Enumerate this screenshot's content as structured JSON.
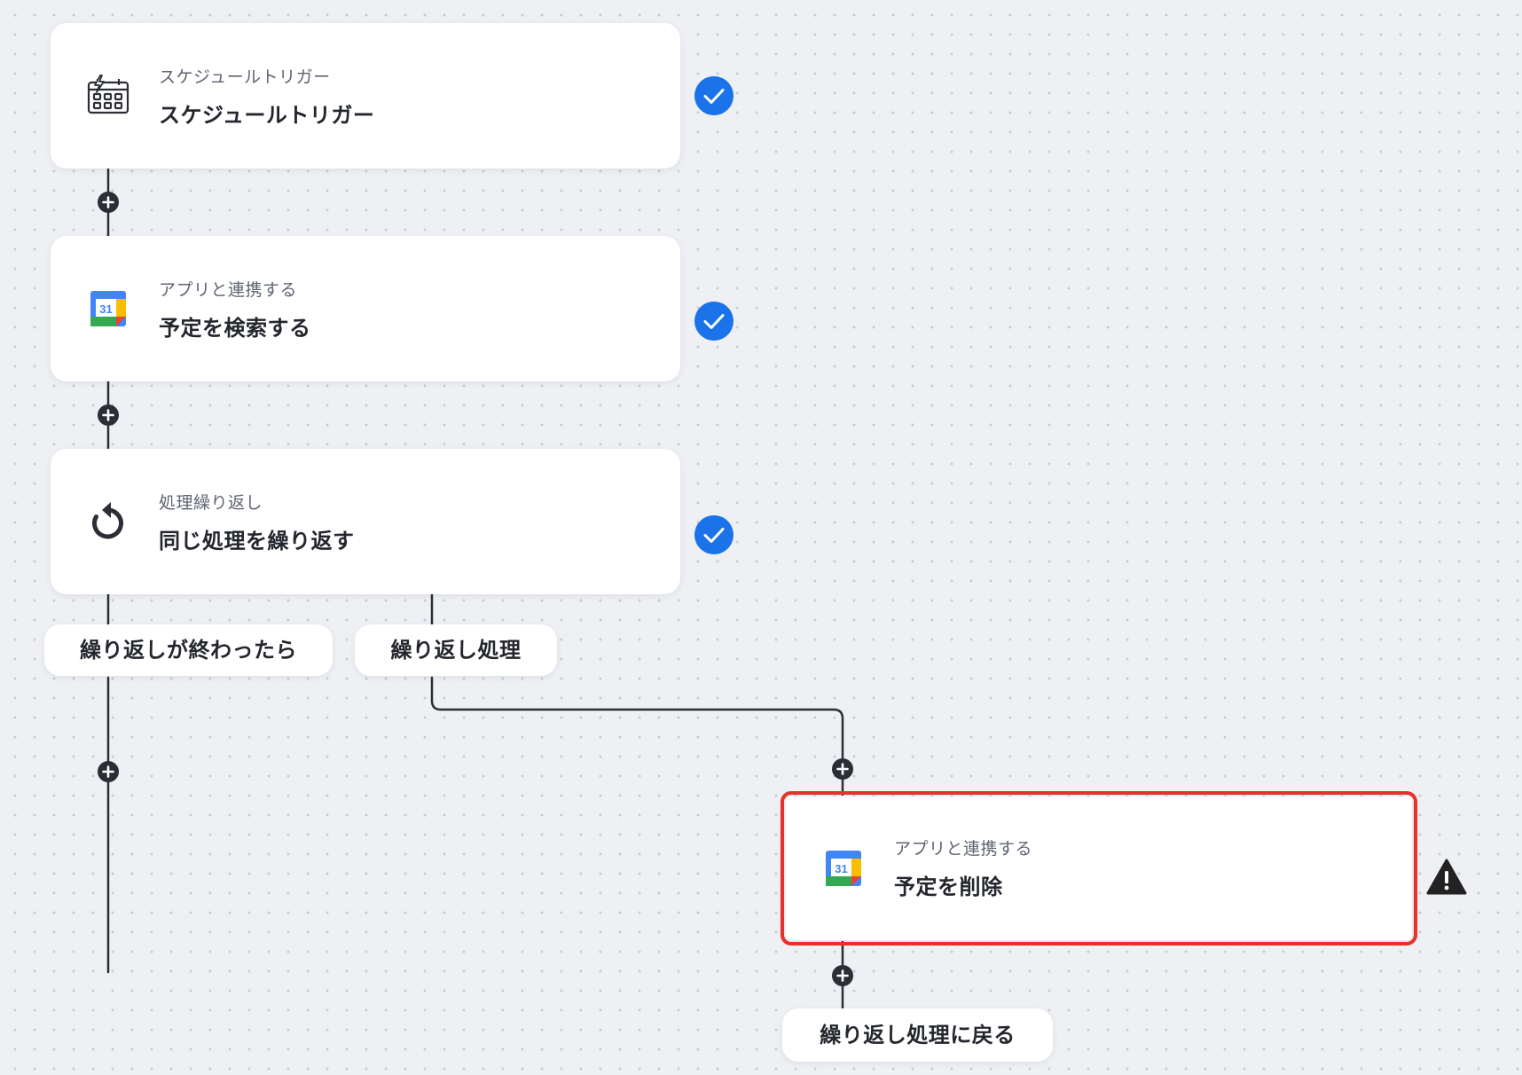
{
  "steps": [
    {
      "subtitle": "スケジュールトリガー",
      "title": "スケジュールトリガー",
      "icon": "schedule-trigger-icon",
      "status": "completed"
    },
    {
      "subtitle": "アプリと連携する",
      "title": "予定を検索する",
      "icon": "google-calendar-icon",
      "status": "completed"
    },
    {
      "subtitle": "処理繰り返し",
      "title": "同じ処理を繰り返す",
      "icon": "loop-icon",
      "status": "completed"
    },
    {
      "subtitle": "アプリと連携する",
      "title": "予定を削除",
      "icon": "google-calendar-icon",
      "status": "warning",
      "selected": true
    }
  ],
  "branches": {
    "after_loop_label": "繰り返しが終わったら",
    "loop_body_label": "繰り返し処理",
    "return_label": "繰り返し処理に戻る"
  },
  "calendar_icon": {
    "day": "31",
    "colors": {
      "blue": "#4285f4",
      "green": "#34a853",
      "yellow": "#fbbc04",
      "red": "#ea4335"
    }
  },
  "colors": {
    "check": "#1a73e8",
    "warning": "#222222",
    "selected_border": "#e5322b",
    "connector": "#2b2e34"
  }
}
